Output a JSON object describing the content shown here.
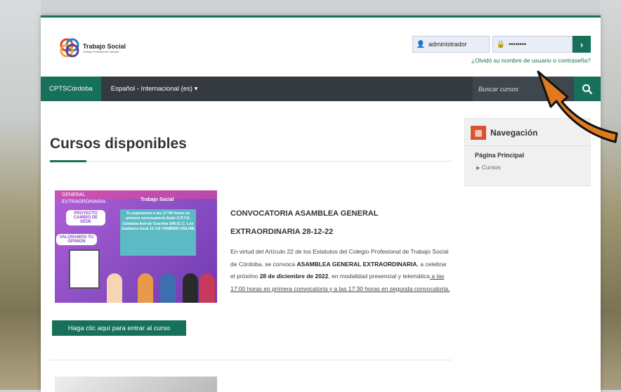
{
  "header": {
    "logo_title": "Trabajo Social",
    "logo_subtitle": "Colegio Profesional Córdoba"
  },
  "login": {
    "username": "administrador",
    "password": "••••••••",
    "forgot_link": "¿Olvidó su nombre de usuario o contraseña?",
    "submit_icon": "chevron-right-icon"
  },
  "navbar": {
    "brand": "CPTSCórdoba",
    "language": "Español - Internacional (es) ▾",
    "search_placeholder": "Buscar cursos",
    "search_icon": "magnifier-icon"
  },
  "main": {
    "heading": "Cursos disponibles",
    "course": {
      "image_texts": {
        "top_left": "GENERAL EXTRAORDINARIA",
        "brand": "Trabajo Social",
        "tag1": "PROYECTO CAMBIO DE SEDE",
        "tag2": "VALORAMOS TU OPINION",
        "box": "Te esperamos a las 17:00 horas en primera convocatoria Sede C.P.T.S. Córdoba Avd de Guerrita S/N (C.C. Los Azahares local 12-13) TAMBIÉN ONLINE"
      },
      "title_line1": "CONVOCATORIA ASAMBLEA GENERAL",
      "title_line2": "EXTRAORDINARIA 28-12-22",
      "desc_part1": "En virtud del Artículo 22 de los Estatutos del Colegio Profesional de Trabajo Social de Córdoba, se convoca ",
      "desc_bold1": "ASAMBLEA GENERAL EXTRAORDINARIA",
      "desc_part2": ", a celebrar el próximo ",
      "desc_bold2": "28 de diciembre de 2022",
      "desc_part3": ", en modalidad presencial y telemática",
      "desc_link": " a las 17:00 horas en primera convocatoria y a las 17:30 horas en segunda convocatoria.",
      "enter_button": "Haga clic aquí para entrar al curso"
    }
  },
  "sidebar": {
    "title": "Navegación",
    "home": "Página Principal",
    "courses": "Cursos"
  },
  "colors": {
    "accent": "#17705a",
    "navbar": "#343a40",
    "nav_icon": "#d9532f",
    "arrow": "#e07a1f"
  }
}
